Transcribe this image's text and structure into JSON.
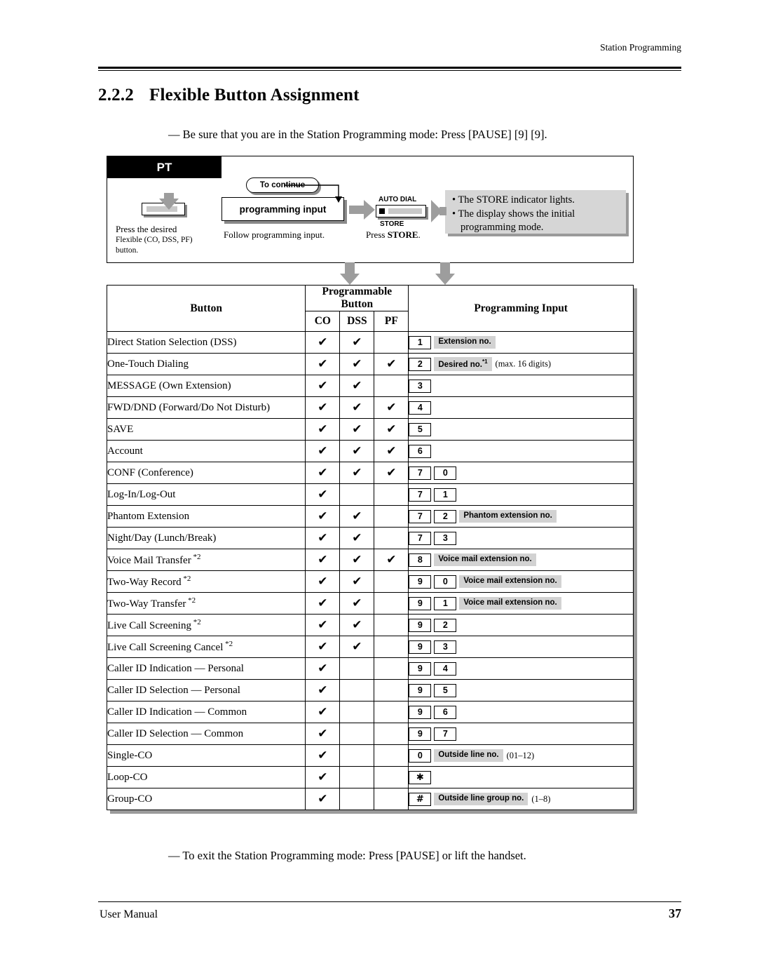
{
  "header": {
    "running_head": "Station Programming"
  },
  "title": {
    "number": "2.2.2",
    "text": "Flexible Button Assignment"
  },
  "intro_line": "— Be sure that you are in the Station Programming mode: Press [PAUSE] [9] [9].",
  "outro_line": "— To exit the Station Programming mode: Press [PAUSE] or lift the handset.",
  "footer": {
    "left": "User Manual",
    "page": "37"
  },
  "flow": {
    "pt_label": "PT",
    "to_continue": "To continue",
    "programming_input": "programming input",
    "auto_dial_label": "AUTO DIAL",
    "store_label": "STORE",
    "caption_press_desired_l1": "Press the desired",
    "caption_press_desired_l2": "Flexible (CO, DSS, PF)",
    "caption_press_desired_l3": "button.",
    "caption_follow": "Follow programming input.",
    "caption_press_store_pre": "Press ",
    "caption_press_store_bold": "STORE",
    "caption_press_store_post": ".",
    "note_line1": "• The STORE indicator lights.",
    "note_line2": "• The display shows the initial",
    "note_line3": "programming mode."
  },
  "table": {
    "headers": {
      "button": "Button",
      "programmable_button": "Programmable Button",
      "co": "CO",
      "dss": "DSS",
      "pf": "PF",
      "programming_input": "Programming   Input"
    },
    "rows": [
      {
        "name": "Direct  Station  Selection  (DSS)",
        "co": true,
        "dss": true,
        "pf": false,
        "input": [
          {
            "type": "key",
            "text": "1"
          },
          {
            "type": "gray",
            "text": "Extension no."
          }
        ]
      },
      {
        "name": "One-Touch Dialing",
        "co": true,
        "dss": true,
        "pf": true,
        "input": [
          {
            "type": "key",
            "text": "2"
          },
          {
            "type": "gray",
            "text": "Desired no.",
            "sup": "*1"
          },
          {
            "type": "paren",
            "text": "(max. 16 digits)"
          }
        ]
      },
      {
        "name": "MESSAGE (Own Extension)",
        "co": true,
        "dss": true,
        "pf": false,
        "input": [
          {
            "type": "key",
            "text": "3"
          }
        ]
      },
      {
        "name": "FWD/DND (Forward/Do Not Disturb)",
        "co": true,
        "dss": true,
        "pf": true,
        "input": [
          {
            "type": "key",
            "text": "4"
          }
        ]
      },
      {
        "name": "SAVE",
        "co": true,
        "dss": true,
        "pf": true,
        "input": [
          {
            "type": "key",
            "text": "5"
          }
        ]
      },
      {
        "name": "Account",
        "co": true,
        "dss": true,
        "pf": true,
        "input": [
          {
            "type": "key",
            "text": "6"
          }
        ]
      },
      {
        "name": "CONF  (Conference)",
        "co": true,
        "dss": true,
        "pf": true,
        "input": [
          {
            "type": "key",
            "text": "7"
          },
          {
            "type": "key",
            "text": "0"
          }
        ]
      },
      {
        "name": "Log-In/Log-Out",
        "co": true,
        "dss": false,
        "pf": false,
        "input": [
          {
            "type": "key",
            "text": "7"
          },
          {
            "type": "key",
            "text": "1"
          }
        ]
      },
      {
        "name": "Phantom Extension",
        "co": true,
        "dss": true,
        "pf": false,
        "input": [
          {
            "type": "key",
            "text": "7"
          },
          {
            "type": "key",
            "text": "2"
          },
          {
            "type": "gray",
            "text": "Phantom  extension  no."
          }
        ]
      },
      {
        "name": "Night/Day (Lunch/Break)",
        "co": true,
        "dss": true,
        "pf": false,
        "input": [
          {
            "type": "key",
            "text": "7"
          },
          {
            "type": "key",
            "text": "3"
          }
        ]
      },
      {
        "name": "Voice  Mail  Transfer",
        "sup": "*2",
        "co": true,
        "dss": true,
        "pf": true,
        "input": [
          {
            "type": "key",
            "text": "8"
          },
          {
            "type": "gray",
            "text": "Voice mail extension no."
          }
        ]
      },
      {
        "name": "Two-Way  Record",
        "sup": "*2",
        "co": true,
        "dss": true,
        "pf": false,
        "input": [
          {
            "type": "key",
            "text": "9"
          },
          {
            "type": "key",
            "text": "0"
          },
          {
            "type": "gray",
            "text": "Voice mail extension no."
          }
        ]
      },
      {
        "name": "Two-Way  Transfer",
        "sup": "*2",
        "co": true,
        "dss": true,
        "pf": false,
        "input": [
          {
            "type": "key",
            "text": "9"
          },
          {
            "type": "key",
            "text": "1"
          },
          {
            "type": "gray",
            "text": "Voice mail extension no."
          }
        ]
      },
      {
        "name": "Live  Call  Screening",
        "sup": "*2",
        "co": true,
        "dss": true,
        "pf": false,
        "input": [
          {
            "type": "key",
            "text": "9"
          },
          {
            "type": "key",
            "text": "2"
          }
        ]
      },
      {
        "name": "Live  Call  Screening  Cancel",
        "sup": "*2",
        "co": true,
        "dss": true,
        "pf": false,
        "input": [
          {
            "type": "key",
            "text": "9"
          },
          {
            "type": "key",
            "text": "3"
          }
        ]
      },
      {
        "name": "Caller ID Indication — Personal",
        "co": true,
        "dss": false,
        "pf": false,
        "input": [
          {
            "type": "key",
            "text": "9"
          },
          {
            "type": "key",
            "text": "4"
          }
        ]
      },
      {
        "name": "Caller ID Selection — Personal",
        "co": true,
        "dss": false,
        "pf": false,
        "input": [
          {
            "type": "key",
            "text": "9"
          },
          {
            "type": "key",
            "text": "5"
          }
        ]
      },
      {
        "name": "Caller ID Indication — Common",
        "co": true,
        "dss": false,
        "pf": false,
        "input": [
          {
            "type": "key",
            "text": "9"
          },
          {
            "type": "key",
            "text": "6"
          }
        ]
      },
      {
        "name": "Caller ID Selection — Common",
        "co": true,
        "dss": false,
        "pf": false,
        "input": [
          {
            "type": "key",
            "text": "9"
          },
          {
            "type": "key",
            "text": "7"
          }
        ]
      },
      {
        "name": "Single-CO",
        "co": true,
        "dss": false,
        "pf": false,
        "input": [
          {
            "type": "key",
            "text": "0"
          },
          {
            "type": "gray",
            "text": "Outside line no."
          },
          {
            "type": "paren",
            "text": "(01–12)"
          }
        ]
      },
      {
        "name": "Loop-CO",
        "co": true,
        "dss": false,
        "pf": false,
        "input": [
          {
            "type": "key",
            "text": "✱",
            "sym": true
          }
        ]
      },
      {
        "name": "Group-CO",
        "co": true,
        "dss": false,
        "pf": false,
        "input": [
          {
            "type": "key",
            "text": "#",
            "sym": true
          },
          {
            "type": "gray",
            "text": "Outside line group no."
          },
          {
            "type": "paren",
            "text": "(1–8)"
          }
        ]
      }
    ],
    "check_glyph": "✔"
  }
}
